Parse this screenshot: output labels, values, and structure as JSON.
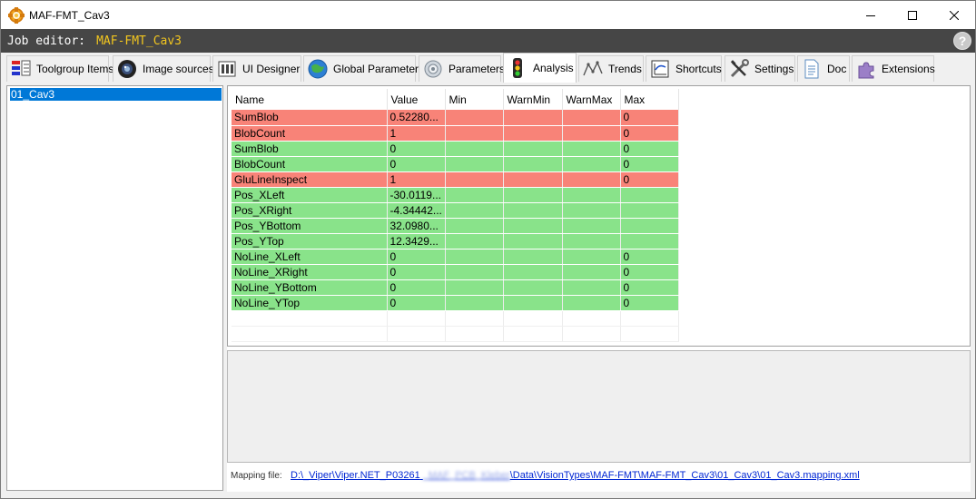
{
  "window": {
    "title": "MAF-FMT_Cav3",
    "minimize_icon": "minimize-icon",
    "maximize_icon": "maximize-icon",
    "close_icon": "close-icon"
  },
  "job_bar": {
    "label": "Job editor:",
    "name": "MAF-FMT_Cav3",
    "help_label": "?"
  },
  "tabs": [
    {
      "label": "Toolgroup Items",
      "icon": "toolgroup-icon"
    },
    {
      "label": "Image sources",
      "icon": "camera-lens-icon"
    },
    {
      "label": "UI Designer",
      "icon": "ui-designer-icon"
    },
    {
      "label": "Global Parameters",
      "icon": "globe-icon"
    },
    {
      "label": "Parameters",
      "icon": "gear-icon"
    },
    {
      "label": "Analysis",
      "icon": "traffic-light-icon",
      "active": true
    },
    {
      "label": "Trends",
      "icon": "trend-line-icon"
    },
    {
      "label": "Shortcuts",
      "icon": "shortcut-chart-icon"
    },
    {
      "label": "Settings",
      "icon": "tools-icon"
    },
    {
      "label": "Doc",
      "icon": "document-icon"
    },
    {
      "label": "Extensions",
      "icon": "puzzle-icon"
    }
  ],
  "tree": {
    "items": [
      "01_Cav3"
    ]
  },
  "grid": {
    "columns": [
      "Name",
      "Value",
      "Min",
      "WarnMin",
      "WarnMax",
      "Max"
    ],
    "rows": [
      {
        "status": "red",
        "cells": [
          "SumBlob",
          "0.52280...",
          "",
          "",
          "",
          "0"
        ]
      },
      {
        "status": "red",
        "cells": [
          "BlobCount",
          "1",
          "",
          "",
          "",
          "0"
        ]
      },
      {
        "status": "green",
        "cells": [
          "SumBlob",
          "0",
          "",
          "",
          "",
          "0"
        ]
      },
      {
        "status": "green",
        "cells": [
          "BlobCount",
          "0",
          "",
          "",
          "",
          "0"
        ]
      },
      {
        "status": "red",
        "cells": [
          "GluLineInspect",
          "1",
          "",
          "",
          "",
          "0"
        ]
      },
      {
        "status": "green",
        "cells": [
          "Pos_XLeft",
          "-30.0119...",
          "",
          "",
          "",
          ""
        ]
      },
      {
        "status": "green",
        "cells": [
          "Pos_XRight",
          "-4.34442...",
          "",
          "",
          "",
          ""
        ]
      },
      {
        "status": "green",
        "cells": [
          "Pos_YBottom",
          "32.0980...",
          "",
          "",
          "",
          ""
        ]
      },
      {
        "status": "green",
        "cells": [
          "Pos_YTop",
          "12.3429...",
          "",
          "",
          "",
          ""
        ]
      },
      {
        "status": "green",
        "cells": [
          "NoLine_XLeft",
          "0",
          "",
          "",
          "",
          "0"
        ]
      },
      {
        "status": "green",
        "cells": [
          "NoLine_XRight",
          "0",
          "",
          "",
          "",
          "0"
        ]
      },
      {
        "status": "green",
        "cells": [
          "NoLine_YBottom",
          "0",
          "",
          "",
          "",
          "0"
        ]
      },
      {
        "status": "green",
        "cells": [
          "NoLine_YTop",
          "0",
          "",
          "",
          "",
          "0"
        ]
      }
    ],
    "colors": {
      "fail": "#f88378",
      "pass": "#89e38a"
    }
  },
  "mapping": {
    "label": "Mapping file:",
    "path_start": "D:\\_Viper\\Viper.NET_P03261",
    "path_redacted": "_MAF_PCB_Kleber",
    "path_end": "\\Data\\VisionTypes\\MAF-FMT\\MAF-FMT_Cav3\\01_Cav3\\01_Cav3.mapping.xml"
  }
}
